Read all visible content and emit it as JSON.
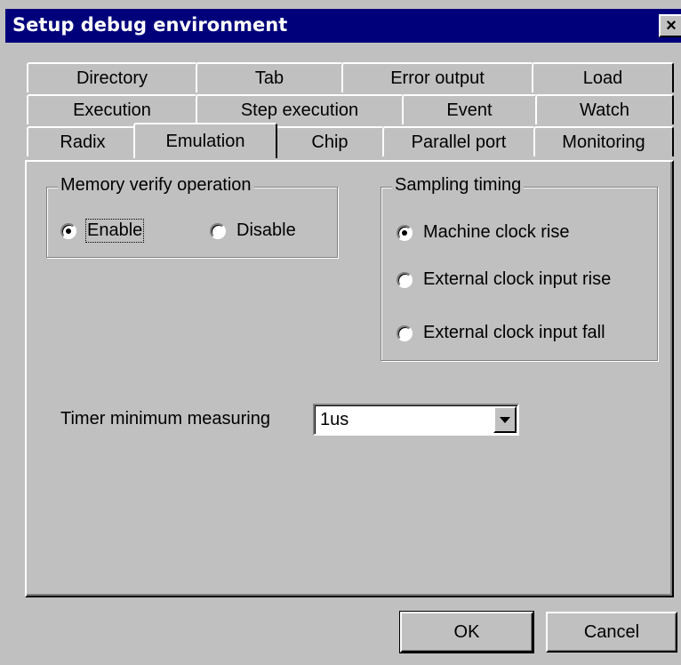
{
  "window": {
    "title": "Setup debug environment",
    "close_glyph": "×"
  },
  "tabs": {
    "row1": [
      "Directory",
      "Tab",
      "Error output",
      "Load"
    ],
    "row2": [
      "Execution",
      "Step execution",
      "Event",
      "Watch"
    ],
    "row3": [
      "Radix",
      "Emulation",
      "Chip",
      "Parallel port",
      "Monitoring"
    ],
    "selected": "Emulation"
  },
  "memory_verify": {
    "label": "Memory verify operation",
    "options": [
      "Enable",
      "Disable"
    ],
    "selected": "Enable"
  },
  "sampling_timing": {
    "label": "Sampling timing",
    "options": [
      "Machine clock rise",
      "External clock input rise",
      "External clock input fall"
    ],
    "selected": "Machine clock rise"
  },
  "timer": {
    "label": "Timer minimum measuring",
    "value": "1us"
  },
  "buttons": {
    "ok": "OK",
    "cancel": "Cancel"
  }
}
